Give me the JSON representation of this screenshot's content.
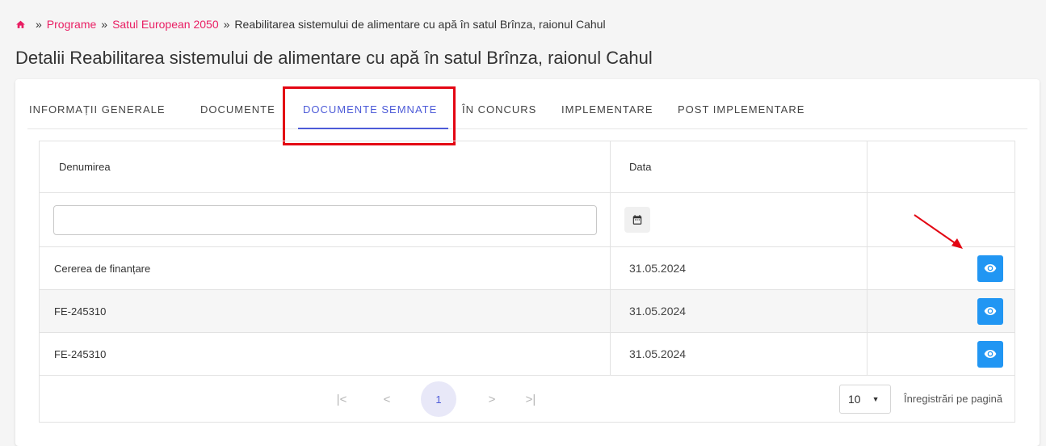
{
  "breadcrumb": {
    "sep": "»",
    "items": [
      "Programe",
      "Satul European 2050",
      "Reabilitarea sistemului de alimentare cu apă în satul Brînza, raionul Cahul"
    ]
  },
  "page_title": "Detalii Reabilitarea sistemului de alimentare cu apă în satul Brînza, raionul Cahul",
  "tabs": [
    {
      "label": "INFORMAȚII GENERALE"
    },
    {
      "label": "DOCUMENTE"
    },
    {
      "label": "DOCUMENTE SEMNATE",
      "active": true
    },
    {
      "label": "ÎN CONCURS"
    },
    {
      "label": "IMPLEMENTARE"
    },
    {
      "label": "POST IMPLEMENTARE"
    }
  ],
  "table": {
    "headers": {
      "name": "Denumirea",
      "date": "Data"
    },
    "filter": {
      "name_value": "",
      "date_icon": "calendar-icon"
    },
    "rows": [
      {
        "name": "Cererea de finanțare",
        "date": "31.05.2024",
        "action_icon": "eye-icon"
      },
      {
        "name": "FE-245310",
        "date": "31.05.2024",
        "action_icon": "eye-icon"
      },
      {
        "name": "FE-245310",
        "date": "31.05.2024",
        "action_icon": "eye-icon"
      }
    ]
  },
  "pagination": {
    "first": "|<",
    "prev": "<",
    "current_page": "1",
    "next": ">",
    "last": ">|",
    "rows_per_page": "10",
    "rows_per_page_label": "Înregistrări pe pagină"
  },
  "colors": {
    "accent": "#4d5bd8",
    "link": "#e91e63",
    "action_button": "#2196f3",
    "annotation": "#e30613"
  }
}
